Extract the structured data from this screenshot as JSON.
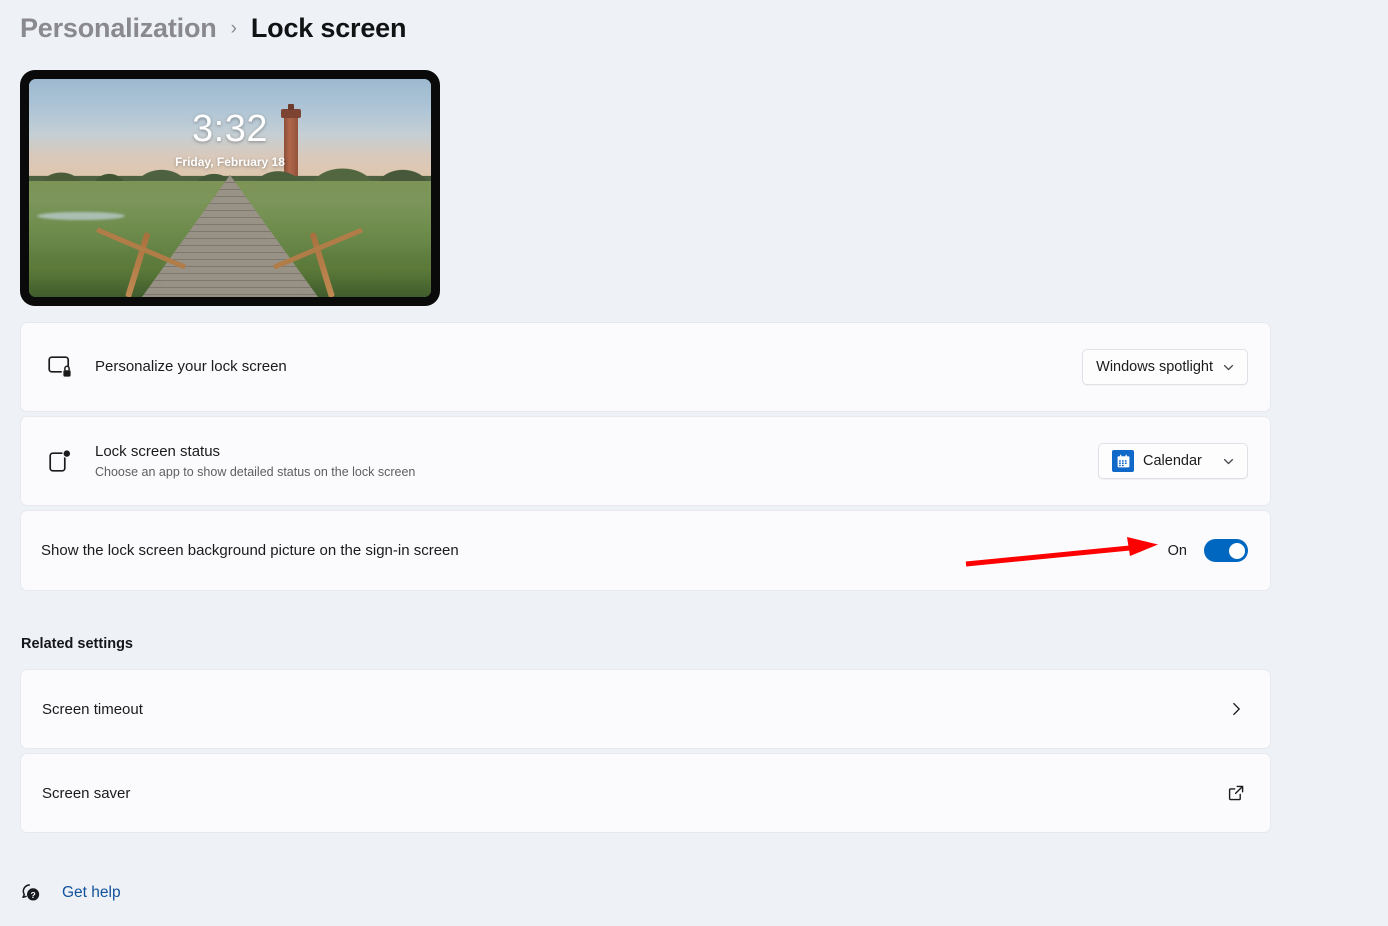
{
  "breadcrumb": {
    "parent": "Personalization",
    "separator": "›",
    "current": "Lock screen"
  },
  "preview": {
    "icon_name": "lock-screen-preview",
    "time": "3:32",
    "date": "Friday, February 18"
  },
  "settings": [
    {
      "icon_name": "lock-screen-icon",
      "title": "Personalize your lock screen",
      "subtitle": "",
      "control": "dropdown",
      "value": "Windows spotlight"
    },
    {
      "icon_name": "lock-screen-status-icon",
      "title": "Lock screen status",
      "subtitle": "Choose an app to show detailed status on the lock screen",
      "control": "dropdown-with-icon",
      "value": "Calendar",
      "value_icon_name": "calendar-app-icon"
    },
    {
      "icon_name": "",
      "title": "Show the lock screen background picture on the sign-in screen",
      "subtitle": "",
      "control": "toggle",
      "value": "On"
    }
  ],
  "related": {
    "heading": "Related settings",
    "items": [
      {
        "title": "Screen timeout",
        "action_icon_name": "chevron-right-icon"
      },
      {
        "title": "Screen saver",
        "action_icon_name": "external-link-icon"
      }
    ]
  },
  "footer": {
    "help_icon_name": "help-question-icon",
    "help_label": "Get help"
  },
  "annotation": {
    "icon_name": "red-arrow-annotation",
    "color": "#ff0000",
    "points_to": "On"
  },
  "colors": {
    "page_background": "#eef1f6",
    "card_background": "#fbfbfd",
    "accent_blue": "#0067c0",
    "calendar_blue": "#1068c9",
    "link_blue": "#11519d",
    "annotation_red": "#ff0000"
  }
}
